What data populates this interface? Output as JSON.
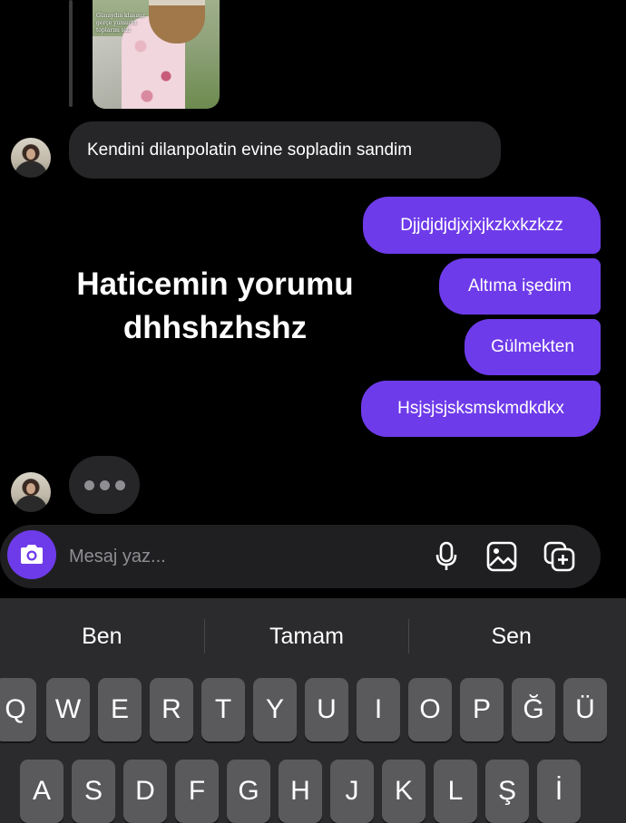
{
  "shared_post": {
    "caption": "Günaydın klasınız gerçe yumurta toplarım sizi"
  },
  "messages": {
    "incoming_1": "Kendini dilanpolatin evine sopladin sandim",
    "outgoing": [
      "Djjdjdjdjxjxjkzkxkzkzz",
      "Altıma işedim",
      "Gülmekten",
      "Hsjsjsjsksmskmdkdkx"
    ]
  },
  "overlay_caption": {
    "line1": "Haticemin yorumu",
    "line2": "dhhshzhshz"
  },
  "composer": {
    "placeholder": "Mesaj yaz..."
  },
  "keyboard": {
    "suggestions": [
      "Ben",
      "Tamam",
      "Sen"
    ],
    "row1": [
      "Q",
      "W",
      "E",
      "R",
      "T",
      "Y",
      "U",
      "I",
      "O",
      "P",
      "Ğ",
      "Ü"
    ],
    "row2": [
      "A",
      "S",
      "D",
      "F",
      "G",
      "H",
      "J",
      "K",
      "L",
      "Ş",
      "İ"
    ]
  },
  "colors": {
    "accent": "#6e3bea",
    "incoming_bubble": "#262628",
    "background": "#000000",
    "keyboard_bg": "#2b2b2d",
    "key_bg": "#5a5a5d"
  },
  "icons": {
    "camera": "camera-icon",
    "microphone": "microphone-icon",
    "gallery": "gallery-icon",
    "sticker": "sticker-icon",
    "typing": "typing-dots-icon"
  }
}
